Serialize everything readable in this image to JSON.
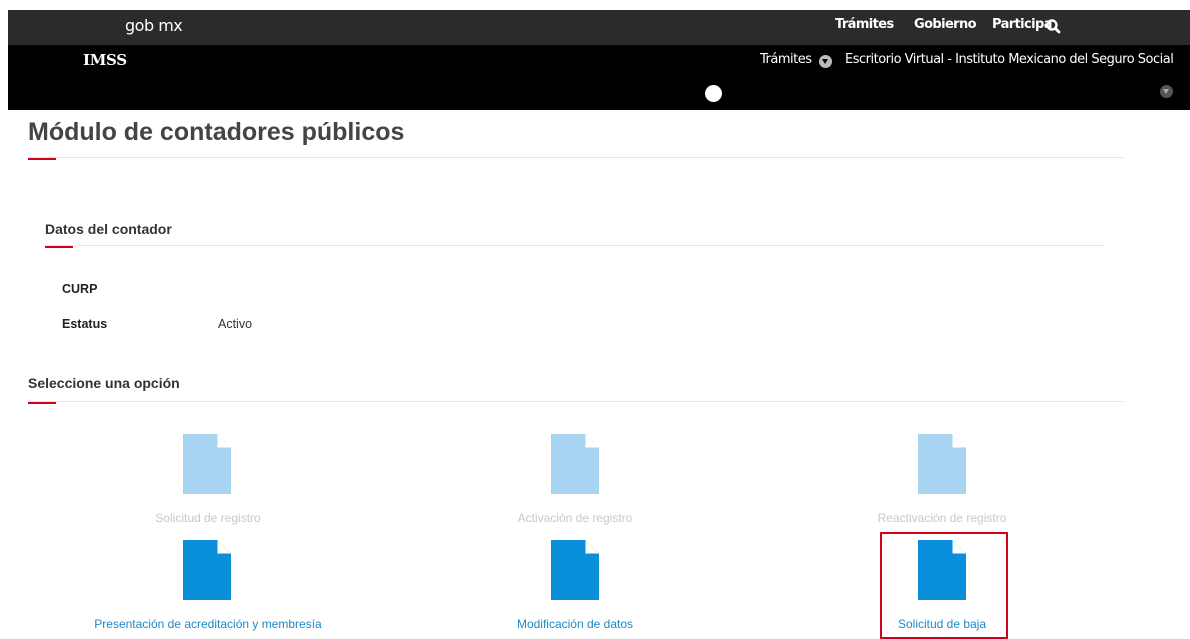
{
  "topbar": {
    "logo": "gob mx",
    "nav": [
      "Trámites",
      "Gobierno",
      "Participa"
    ]
  },
  "subbar": {
    "brand": "IMSS",
    "tramites": "Trámites",
    "escritorio": "Escritorio Virtual - Instituto Mexicano del Seguro Social"
  },
  "page": {
    "title": "Módulo de contadores públicos"
  },
  "contador": {
    "section_title": "Datos del contador",
    "curp_label": "CURP",
    "curp_value": "",
    "estatus_label": "Estatus",
    "estatus_value": "Activo"
  },
  "opciones": {
    "section_title": "Seleccione una opción",
    "items": [
      {
        "label": "Solicitud de registro",
        "enabled": false
      },
      {
        "label": "Activación de registro",
        "enabled": false
      },
      {
        "label": "Reactivación de registro",
        "enabled": false
      },
      {
        "label": "Presentación de acreditación y membresía",
        "enabled": true
      },
      {
        "label": "Modificación de datos",
        "enabled": true
      },
      {
        "label": "Solicitud de baja",
        "enabled": true,
        "highlighted": true
      }
    ]
  },
  "colors": {
    "accent_red": "#d0021b",
    "link_blue": "#1e88c8",
    "doc_disabled": "#a9d5f2",
    "doc_enabled": "#0a8fdb"
  }
}
